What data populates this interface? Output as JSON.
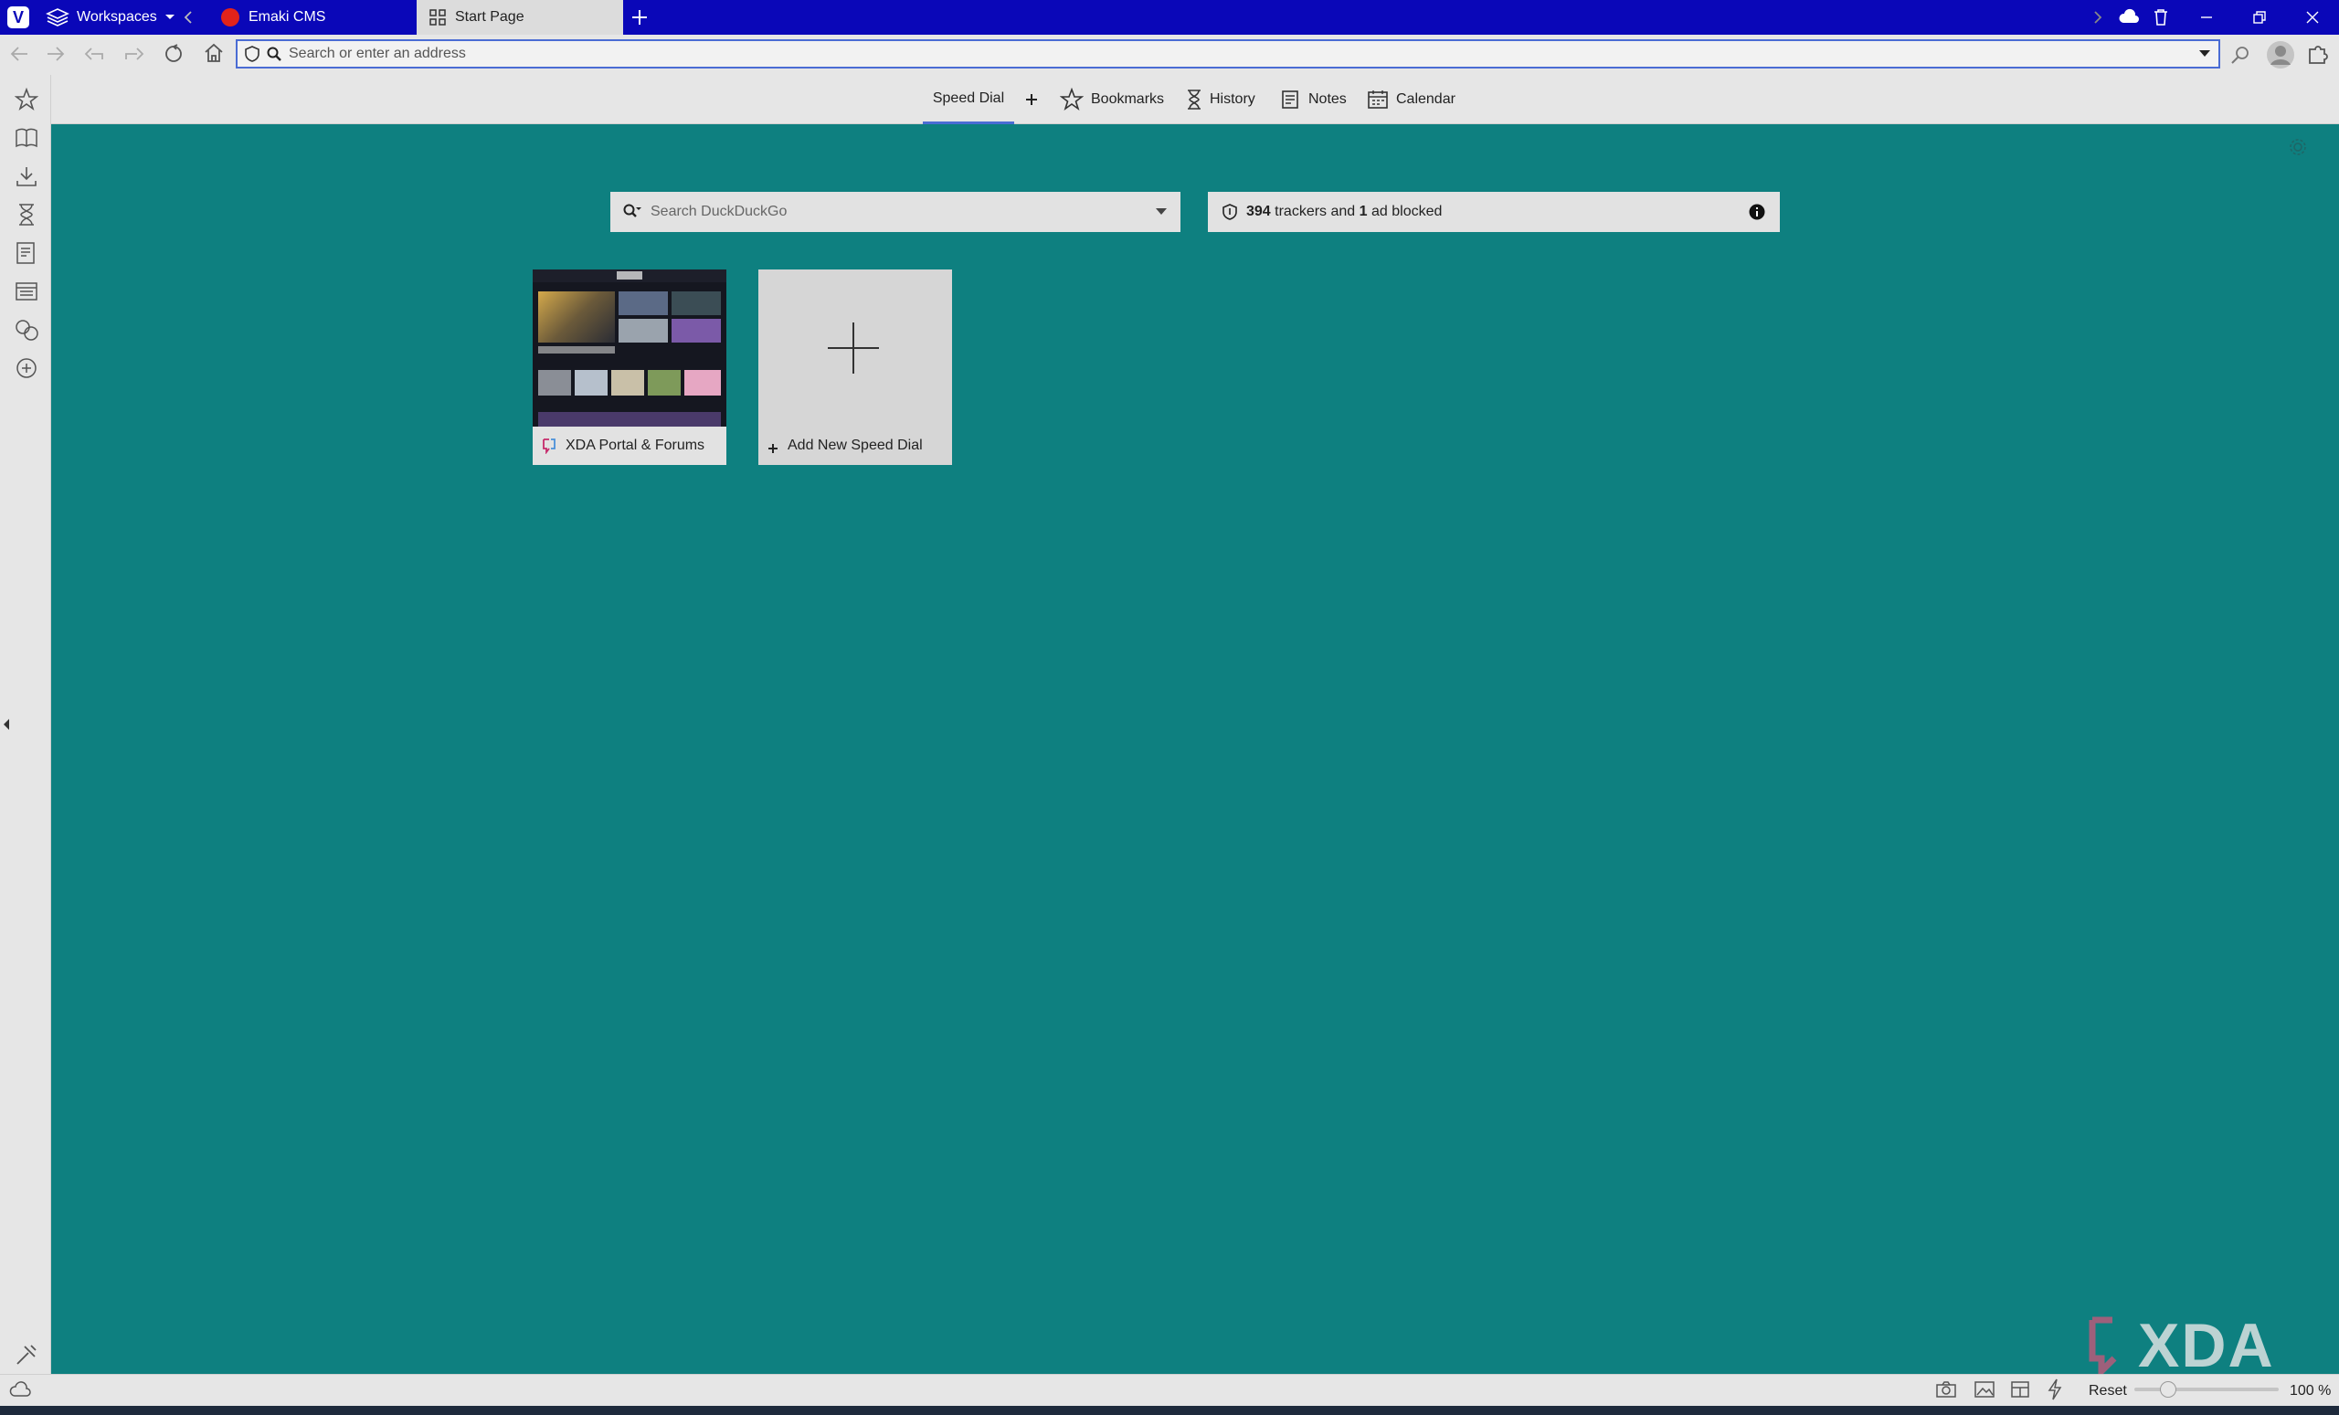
{
  "tabbar": {
    "workspaces_label": "Workspaces",
    "tabs": [
      {
        "label": "Emaki CMS",
        "icon": "emaki-favicon"
      },
      {
        "label": "Start Page",
        "icon": "grid-icon"
      }
    ]
  },
  "address": {
    "placeholder": "Search or enter an address"
  },
  "startnav": {
    "items": [
      {
        "label": "Speed Dial"
      },
      {
        "label": "Bookmarks",
        "icon": "star-icon"
      },
      {
        "label": "History",
        "icon": "hourglass-icon"
      },
      {
        "label": "Notes",
        "icon": "notes-icon"
      },
      {
        "label": "Calendar",
        "icon": "calendar-icon"
      }
    ]
  },
  "search": {
    "placeholder": "Search DuckDuckGo"
  },
  "tracker": {
    "trackers": "394",
    "text1": "trackers and",
    "ads": "1",
    "text2": "ad blocked"
  },
  "speed_dials": [
    {
      "label": "XDA Portal & Forums"
    },
    {
      "label": "Add New Speed Dial"
    }
  ],
  "statusbar": {
    "reset_label": "Reset",
    "zoom": "100 %"
  },
  "watermark": "XDA",
  "colors": {
    "tabbar": "#0a07b8",
    "page_bg": "#0e8080",
    "accent": "#4a6cd4"
  }
}
